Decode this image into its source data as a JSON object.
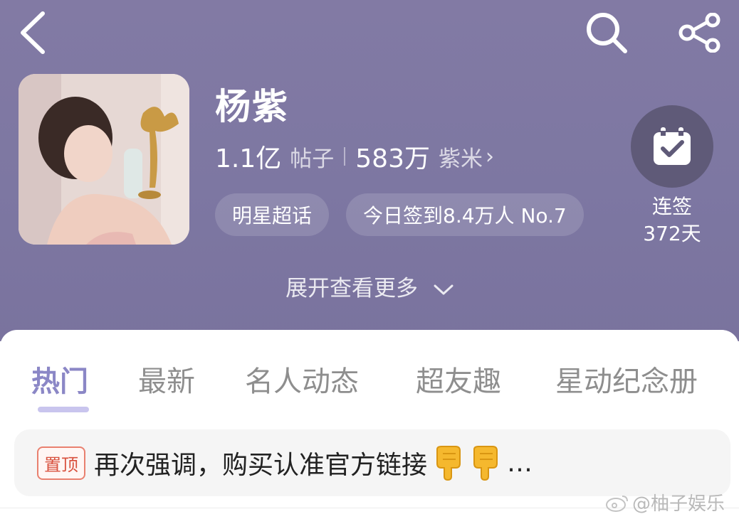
{
  "header": {
    "title": "杨紫",
    "stats": {
      "posts_count": "1.1亿",
      "posts_unit": "帖子",
      "fans_count": "583万",
      "fans_unit": "紫米",
      "fans_chevron": "›"
    },
    "chips": [
      "明星超话",
      "今日签到8.4万人 No.7"
    ],
    "checkin": {
      "line1": "连签",
      "line2": "372天"
    },
    "expand_label": "展开查看更多"
  },
  "icons": {
    "back": "back-arrow-icon",
    "search": "search-icon",
    "share": "share-icon",
    "checkin": "calendar-check-icon"
  },
  "tabs": [
    "热门",
    "最新",
    "名人动态",
    "超友趣",
    "星动纪念册"
  ],
  "active_tab": "热门",
  "pinned_post": {
    "badge": "置顶",
    "text": "再次强调，购买认准官方链接",
    "suffix": "…"
  },
  "watermark": "@柚子娱乐",
  "colors": {
    "header_bg": "#7d77a2",
    "active_tab": "#8b87c6",
    "tab_indicator": "#c9c5ee",
    "pin_badge": "#e9806f",
    "checkin_circle": "#5f5a78"
  }
}
